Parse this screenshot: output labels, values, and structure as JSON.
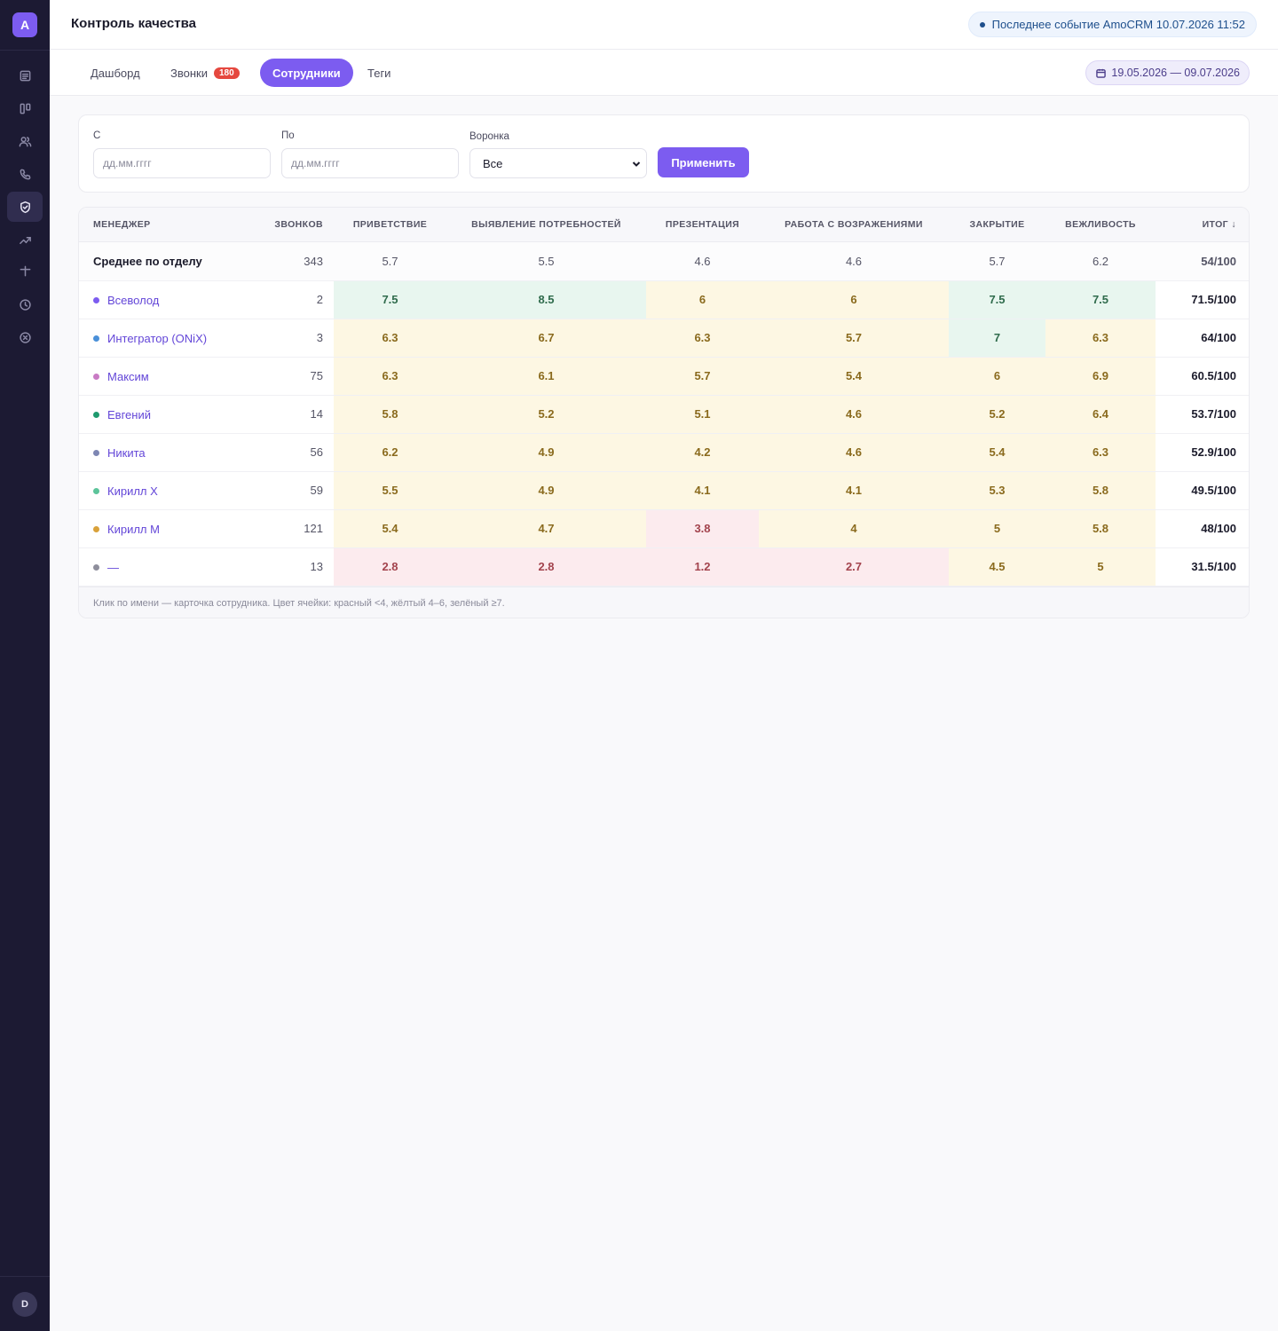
{
  "app": {
    "logo_letter": "A",
    "user_initial": "D"
  },
  "header": {
    "title": "Контроль качества",
    "last_event": "Последнее событие AmoCRM 10.07.2026 11:52"
  },
  "sidebar": {
    "items": [
      {
        "icon": "document-icon",
        "active": false
      },
      {
        "icon": "kanban-icon",
        "active": false
      },
      {
        "icon": "users-icon",
        "active": false
      },
      {
        "icon": "phone-icon",
        "active": false
      },
      {
        "icon": "shield-check-icon",
        "active": true
      },
      {
        "icon": "trend-up-icon",
        "active": false
      },
      {
        "icon": "plus-icon",
        "active": false
      },
      {
        "icon": "clock-icon",
        "active": false
      },
      {
        "icon": "x-circle-icon",
        "active": false
      }
    ]
  },
  "tabs": [
    {
      "label": "Дашборд",
      "active": false
    },
    {
      "label": "Звонки",
      "badge": "180",
      "active": false
    },
    {
      "label": "Сотрудники",
      "active": true
    },
    {
      "label": "Теги",
      "active": false
    }
  ],
  "date_range": "19.05.2026 — 09.07.2026",
  "filters": {
    "from_label": "С",
    "from_placeholder": "дд.мм.гггг",
    "to_label": "По",
    "to_placeholder": "дд.мм.гггг",
    "funnel_label": "Воронка",
    "funnel_value": "Все",
    "apply_label": "Применить"
  },
  "table": {
    "columns": [
      "Менеджер",
      "Звонков",
      "Приветствие",
      "Выявление потребностей",
      "Презентация",
      "Работа с возражениями",
      "Закрытие",
      "Вежливость",
      "Итог ↓"
    ],
    "average": {
      "name": "Среднее по отделу",
      "calls": "343",
      "scores": [
        "5.7",
        "5.5",
        "4.6",
        "4.6",
        "5.7",
        "6.2"
      ],
      "total": "54/100"
    },
    "rows": [
      {
        "name": "Всеволод",
        "dot": "#7c5cf0",
        "calls": "2",
        "scores": [
          "7.5",
          "8.5",
          "6",
          "6",
          "7.5",
          "7.5"
        ],
        "levels": [
          "g",
          "g",
          "y",
          "y",
          "g",
          "g"
        ],
        "total": "71.5/100"
      },
      {
        "name": "Интегратор (ONiX)",
        "dot": "#4a90d9",
        "calls": "3",
        "scores": [
          "6.3",
          "6.7",
          "6.3",
          "5.7",
          "7",
          "6.3"
        ],
        "levels": [
          "y",
          "y",
          "y",
          "y",
          "g",
          "y"
        ],
        "total": "64/100"
      },
      {
        "name": "Максим",
        "dot": "#c97bc4",
        "calls": "75",
        "scores": [
          "6.3",
          "6.1",
          "5.7",
          "5.4",
          "6",
          "6.9"
        ],
        "levels": [
          "y",
          "y",
          "y",
          "y",
          "y",
          "y"
        ],
        "total": "60.5/100"
      },
      {
        "name": "Евгений",
        "dot": "#1f9a6e",
        "calls": "14",
        "scores": [
          "5.8",
          "5.2",
          "5.1",
          "4.6",
          "5.2",
          "6.4"
        ],
        "levels": [
          "y",
          "y",
          "y",
          "y",
          "y",
          "y"
        ],
        "total": "53.7/100"
      },
      {
        "name": "Никита",
        "dot": "#7d86b3",
        "calls": "56",
        "scores": [
          "6.2",
          "4.9",
          "4.2",
          "4.6",
          "5.4",
          "6.3"
        ],
        "levels": [
          "y",
          "y",
          "y",
          "y",
          "y",
          "y"
        ],
        "total": "52.9/100"
      },
      {
        "name": "Кирилл Х",
        "dot": "#5cc49a",
        "calls": "59",
        "scores": [
          "5.5",
          "4.9",
          "4.1",
          "4.1",
          "5.3",
          "5.8"
        ],
        "levels": [
          "y",
          "y",
          "y",
          "y",
          "y",
          "y"
        ],
        "total": "49.5/100"
      },
      {
        "name": "Кирилл М",
        "dot": "#d9a13a",
        "calls": "121",
        "scores": [
          "5.4",
          "4.7",
          "3.8",
          "4",
          "5",
          "5.8"
        ],
        "levels": [
          "y",
          "y",
          "r",
          "y",
          "y",
          "y"
        ],
        "total": "48/100"
      },
      {
        "name": "—",
        "dot": "#8e8e9c",
        "calls": "13",
        "scores": [
          "2.8",
          "2.8",
          "1.2",
          "2.7",
          "4.5",
          "5"
        ],
        "levels": [
          "r",
          "r",
          "r",
          "r",
          "y",
          "y"
        ],
        "total": "31.5/100"
      }
    ],
    "footnote": "Клик по имени — карточка сотрудника. Цвет ячейки: красный <4, жёлтый 4–6, зелёный ≥7."
  }
}
